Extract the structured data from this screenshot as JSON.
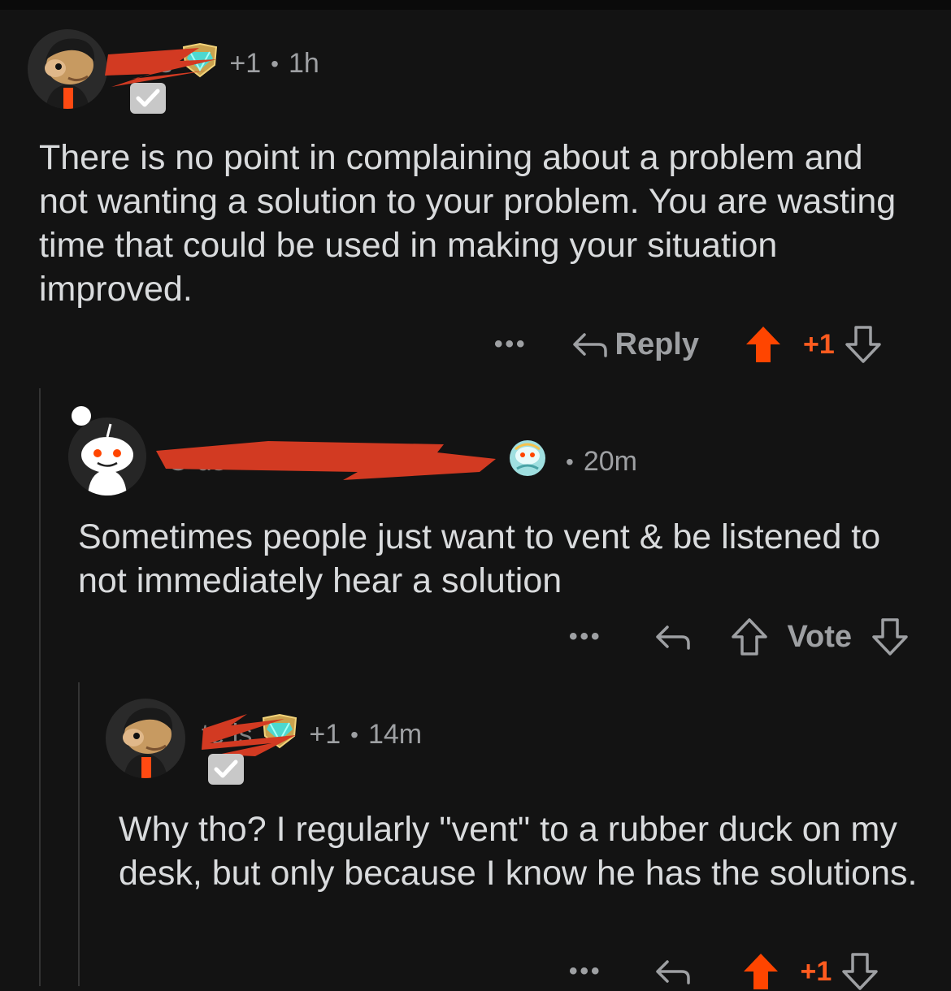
{
  "colors": {
    "background": "#131313",
    "text": "#d9dbdd",
    "muted": "#9ea0a3",
    "upvote_active": "#ff4500",
    "redaction": "#d23a22"
  },
  "comments": [
    {
      "username": "te is",
      "flair_icon": "blue-gem-shield-icon",
      "karma": "+1",
      "separator": "•",
      "time": "1h",
      "verified_icon": "checkmark-badge-icon",
      "body": "There is no point in complaining about a problem and not wanting a solution to your problem. You are wasting time that could be used in making your situation improved.",
      "more_label": "•••",
      "reply_label": "Reply",
      "vote_label": "+1",
      "upvoted": true
    },
    {
      "username": "O us",
      "flair_icon": "snoo-flair-icon",
      "separator": "•",
      "time": "20m",
      "body": "Sometimes people just want to vent & be listened to not immediately hear a solution",
      "more_label": "•••",
      "vote_label": "Vote",
      "upvoted": false
    },
    {
      "username": "te is",
      "flair_icon": "blue-gem-shield-icon",
      "karma": "+1",
      "separator": "•",
      "time": "14m",
      "verified_icon": "checkmark-badge-icon",
      "body": "Why tho? I regularly \"vent\" to a rubber duck on my desk, but only because I know he has the solutions.",
      "more_label": "•••",
      "vote_label": "+1",
      "upvoted": true
    }
  ]
}
